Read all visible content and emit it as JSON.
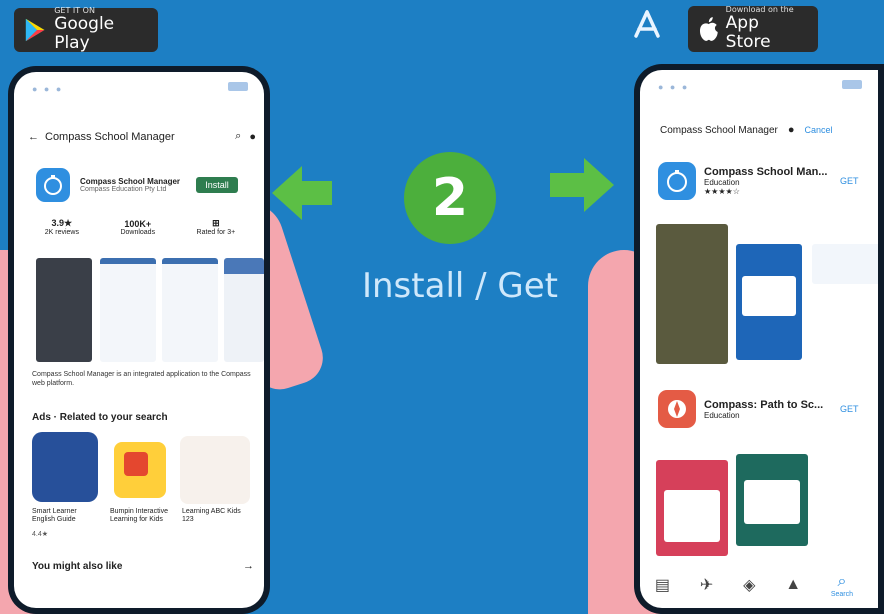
{
  "google_play_badge": {
    "small": "GET IT ON",
    "big": "Google Play"
  },
  "app_store_badge": {
    "small": "Download on the",
    "big": "App Store"
  },
  "step": {
    "number": "2",
    "label": "Install / Get"
  },
  "android": {
    "search_title": "Compass School Manager",
    "app_name": "Compass School Manager",
    "developer": "Compass Education Pty Ltd",
    "install_button": "Install",
    "stats": [
      {
        "value": "3.9★",
        "label": "2K reviews"
      },
      {
        "value": "100K+",
        "label": "Downloads"
      },
      {
        "value": "⊞",
        "label": "Rated for 3+"
      }
    ],
    "description": "Compass School Manager is an integrated application to the Compass web platform.",
    "related_heading": "Ads · Related to your search",
    "related_apps": [
      {
        "name": "Smart Learner English Guide",
        "rating": "4.4★"
      },
      {
        "name": "Bumpin Interactive Learning for Kids",
        "rating": ""
      },
      {
        "name": "Learning ABC Kids 123",
        "rating": ""
      }
    ],
    "also_like": "You might also like",
    "also_like_arrow": "→"
  },
  "ios": {
    "search_title": "Compass School Manager",
    "cancel": "Cancel",
    "results": [
      {
        "name": "Compass School Man...",
        "category": "Education",
        "rating": "★★★★☆",
        "button": "GET"
      },
      {
        "name": "Compass: Path to Sc...",
        "category": "Education",
        "rating": "",
        "button": "GET"
      }
    ],
    "tabs": [
      {
        "icon": "▤",
        "label": ""
      },
      {
        "icon": "✈",
        "label": ""
      },
      {
        "icon": "◈",
        "label": ""
      },
      {
        "icon": "▲",
        "label": ""
      },
      {
        "icon": "⌕",
        "label": "Search"
      }
    ]
  },
  "colors": {
    "background": "#1d7fc4",
    "green": "#4caf3c",
    "phone_frame": "#0e1b2a",
    "hand": "#f4a6ae",
    "app_blue": "#2f8fe0"
  }
}
